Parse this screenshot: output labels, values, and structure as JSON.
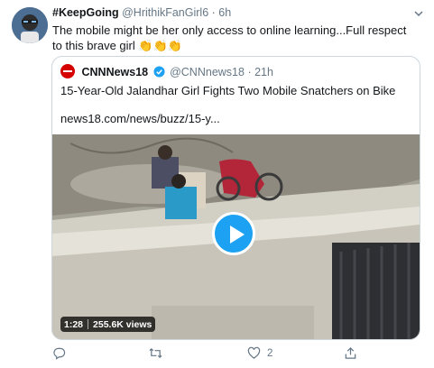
{
  "tweet": {
    "display_name": "#KeepGoing",
    "handle": "@HrithikFanGirl6",
    "separator": "·",
    "time": "6h",
    "text": "The mobile might be her only access to online learning...Full respect to this brave girl 👏👏👏"
  },
  "quoted": {
    "display_name": "CNNNews18",
    "handle": "@CNNnews18",
    "separator": "·",
    "time": "21h",
    "title": "15-Year-Old Jalandhar Girl Fights Two Mobile Snatchers on Bike",
    "link": "news18.com/news/buzz/15-y...",
    "video": {
      "duration": "1:28",
      "views": "255.6K views"
    }
  },
  "actions": {
    "reply_count": "",
    "retweet_count": "",
    "like_count": "2"
  },
  "colors": {
    "accent": "#1da1f2",
    "muted": "#657786",
    "border": "#ccd6dd",
    "brand": "#d40000"
  }
}
